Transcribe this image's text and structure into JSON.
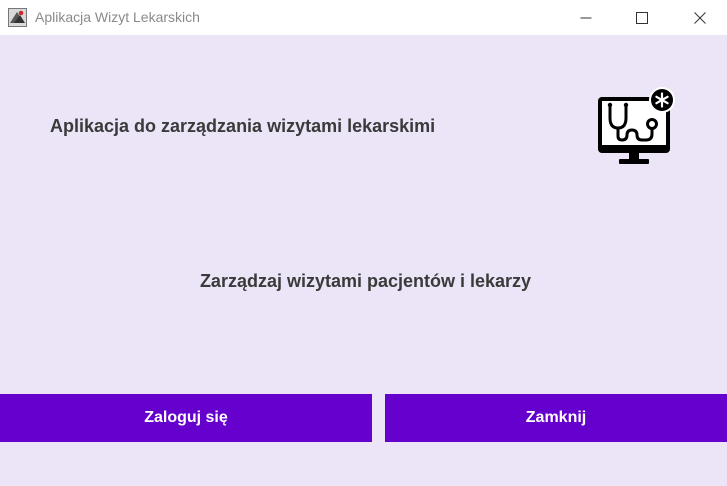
{
  "window": {
    "title": "Aplikacja Wizyt Lekarskich",
    "icons": {
      "app": "app-icon",
      "minimize": "minimize-icon",
      "maximize": "maximize-icon",
      "close": "close-icon"
    }
  },
  "main": {
    "heading": "Aplikacja do zarządzania wizytami lekarskimi",
    "subheading": "Zarządzaj wizytami pacjentów i lekarzy",
    "logo_icon": "telemedicine-stethoscope-monitor-icon"
  },
  "buttons": {
    "login": "Zaloguj się",
    "close": "Zamknij"
  },
  "colors": {
    "background": "#ebe5f7",
    "button": "#6600cc",
    "button_text": "#ffffff",
    "text": "#3a3a3a"
  }
}
